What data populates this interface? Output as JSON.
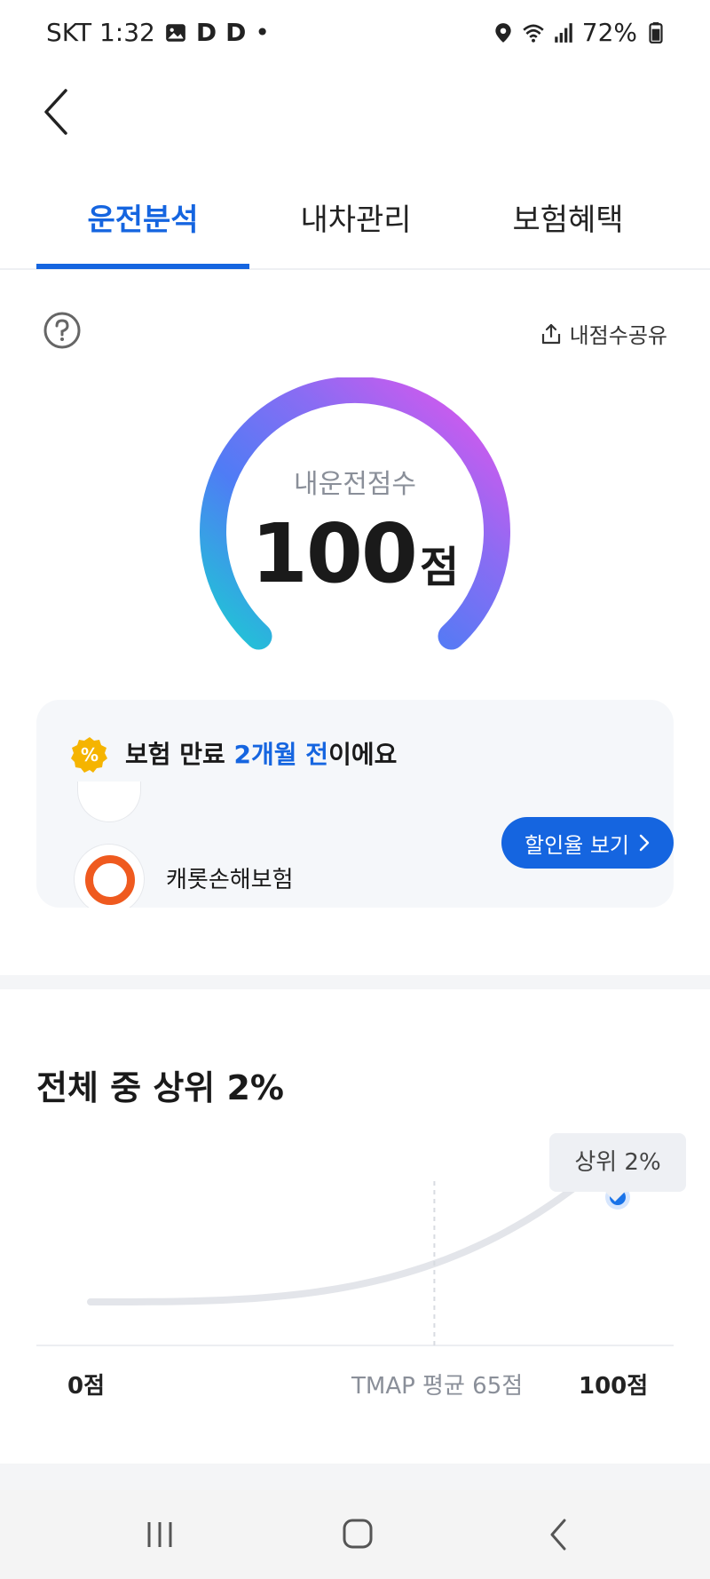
{
  "status": {
    "carrier_time": "SKT 1:32",
    "app_icons": [
      "D",
      "D"
    ],
    "dot": "•",
    "battery": "72%"
  },
  "tabs": [
    {
      "label": "운전분석",
      "active": true
    },
    {
      "label": "내차관리",
      "active": false
    },
    {
      "label": "보험혜택",
      "active": false
    }
  ],
  "header": {
    "share_label": "내점수공유"
  },
  "gauge": {
    "label": "내운전점수",
    "score": "100",
    "unit": "점",
    "score_value": 100,
    "colors": [
      "#1ec8d4",
      "#4f7cf5",
      "#8a6cf3",
      "#e554ec"
    ]
  },
  "promo": {
    "title_pre": "보험 만료 ",
    "title_highlight": "2개월 전",
    "title_post": "이에요",
    "badge": "%",
    "insurer_name": "캐롯손해보험",
    "button_label": "할인율 보기",
    "accent": "#1565e0"
  },
  "rank": {
    "title": "전체 중 상위 2%",
    "tooltip": "상위 2%",
    "axis_start": "0점",
    "axis_avg": "TMAP 평균 65점",
    "axis_end": "100점",
    "avg_value": 65,
    "my_score": 100
  },
  "colors": {
    "accent": "#1565e0",
    "point": "#1a73e8"
  }
}
